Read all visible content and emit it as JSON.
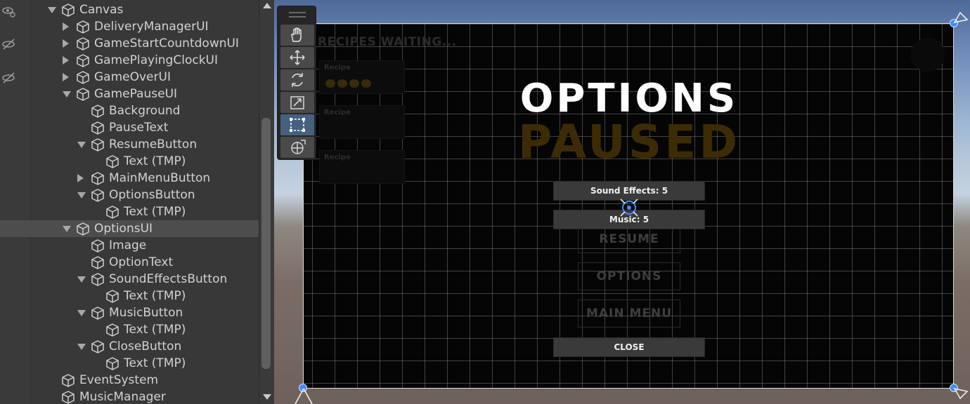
{
  "colors": {
    "hierarchy_bg": "#383838",
    "selected_row_bg": "#4d4d4d",
    "text": "#d2d2d2",
    "gizmo_blue": "#3f8cff",
    "paused_text": "#3c2b05"
  },
  "hierarchy": {
    "items": [
      {
        "label": "Canvas",
        "depth": 0,
        "expander": "down"
      },
      {
        "label": "DeliveryManagerUI",
        "depth": 1,
        "expander": "right"
      },
      {
        "label": "GameStartCountdownUI",
        "depth": 1,
        "expander": "right"
      },
      {
        "label": "GamePlayingClockUI",
        "depth": 1,
        "expander": "right"
      },
      {
        "label": "GameOverUI",
        "depth": 1,
        "expander": "right"
      },
      {
        "label": "GamePauseUI",
        "depth": 1,
        "expander": "down"
      },
      {
        "label": "Background",
        "depth": 2,
        "expander": "none"
      },
      {
        "label": "PauseText",
        "depth": 2,
        "expander": "none"
      },
      {
        "label": "ResumeButton",
        "depth": 2,
        "expander": "down"
      },
      {
        "label": "Text (TMP)",
        "depth": 3,
        "expander": "none"
      },
      {
        "label": "MainMenuButton",
        "depth": 2,
        "expander": "right"
      },
      {
        "label": "OptionsButton",
        "depth": 2,
        "expander": "down"
      },
      {
        "label": "Text (TMP)",
        "depth": 3,
        "expander": "none"
      },
      {
        "label": "OptionsUI",
        "depth": 1,
        "expander": "down",
        "selected": true
      },
      {
        "label": "Image",
        "depth": 2,
        "expander": "none"
      },
      {
        "label": "OptionText",
        "depth": 2,
        "expander": "none"
      },
      {
        "label": "SoundEffectsButton",
        "depth": 2,
        "expander": "down"
      },
      {
        "label": "Text (TMP)",
        "depth": 3,
        "expander": "none"
      },
      {
        "label": "MusicButton",
        "depth": 2,
        "expander": "down"
      },
      {
        "label": "Text (TMP)",
        "depth": 3,
        "expander": "none"
      },
      {
        "label": "CloseButton",
        "depth": 2,
        "expander": "down"
      },
      {
        "label": "Text (TMP)",
        "depth": 3,
        "expander": "none"
      },
      {
        "label": "EventSystem",
        "depth": 0,
        "expander": "none"
      },
      {
        "label": "MusicManager",
        "depth": 0,
        "expander": "none"
      }
    ]
  },
  "toolbar": {
    "tools": [
      {
        "name": "hand-tool",
        "icon": "hand-icon"
      },
      {
        "name": "move-tool",
        "icon": "move-icon"
      },
      {
        "name": "rotate-tool",
        "icon": "rotate-icon"
      },
      {
        "name": "scale-tool",
        "icon": "scale-icon"
      },
      {
        "name": "rect-tool",
        "icon": "rect-icon",
        "active": true
      },
      {
        "name": "transform-tool",
        "icon": "transform-icon"
      }
    ]
  },
  "scene": {
    "recipes_title": "RECIPES WAITING...",
    "recipe_label": "Recipe",
    "options_title": "OPTIONS",
    "paused_title": "PAUSED",
    "sound_effects_button": "Sound Effects: 5",
    "music_button": "Music: 5",
    "resume_button": "RESUME",
    "options_button": "OPTIONS",
    "main_menu_button": "MAIN MENU",
    "close_button": "CLOSE"
  }
}
